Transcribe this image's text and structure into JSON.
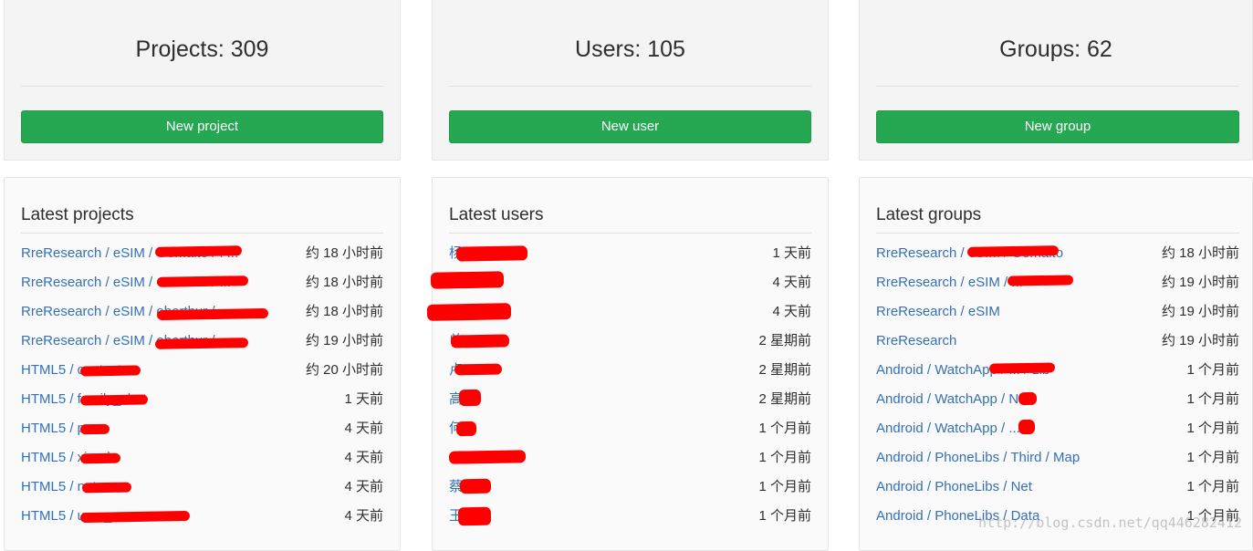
{
  "stats": [
    {
      "title": "Projects: 309",
      "button": "New project"
    },
    {
      "title": "Users: 105",
      "button": "New user"
    },
    {
      "title": "Groups: 62",
      "button": "New group"
    }
  ],
  "lists": [
    {
      "heading": "Latest projects",
      "rows": [
        {
          "name": "RreResearch / eSIM / Gemalto / P...",
          "time": "约 18 小时前"
        },
        {
          "name": "RreResearch / eSIM / Gemalto / ...",
          "time": "约 18 小时前"
        },
        {
          "name": "RreResearch / eSIM / oberthur / ...",
          "time": "约 18 小时前"
        },
        {
          "name": "RreResearch / eSIM / oberthur / ...",
          "time": "约 19 小时前"
        },
        {
          "name": "HTML5 / contact",
          "time": "约 20 小时前"
        },
        {
          "name": "HTML5 / family_chat",
          "time": "1 天前"
        },
        {
          "name": "HTML5 / p...",
          "time": "4 天前"
        },
        {
          "name": "HTML5 / xiaodu",
          "time": "4 天前"
        },
        {
          "name": "HTML5 / netease",
          "time": "4 天前"
        },
        {
          "name": "HTML5 / user_c...",
          "time": "4 天前"
        }
      ]
    },
    {
      "heading": "Latest users",
      "rows": [
        {
          "name": "杨",
          "time": "1 天前"
        },
        {
          "name": "",
          "time": "4 天前"
        },
        {
          "name": "曹",
          "time": "4 天前"
        },
        {
          "name": "曾",
          "time": "2 星期前"
        },
        {
          "name": "卢",
          "time": "2 星期前"
        },
        {
          "name": "高",
          "time": "2 星期前"
        },
        {
          "name": "何",
          "time": "1 个月前"
        },
        {
          "name": "",
          "time": "1 个月前"
        },
        {
          "name": "蔡",
          "time": "1 个月前"
        },
        {
          "name": "王",
          "time": "1 个月前"
        }
      ]
    },
    {
      "heading": "Latest groups",
      "rows": [
        {
          "name": "RreResearch / eSIM / Gemalto",
          "time": "约 18 小时前"
        },
        {
          "name": "RreResearch / eSIM / ...",
          "time": "约 19 小时前"
        },
        {
          "name": "RreResearch / eSIM",
          "time": "约 19 小时前"
        },
        {
          "name": "RreResearch",
          "time": "约 19 小时前"
        },
        {
          "name": "Android / WatchApp / ... / Lib",
          "time": "1 个月前"
        },
        {
          "name": "Android / WatchApp / N...",
          "time": "1 个月前"
        },
        {
          "name": "Android / WatchApp / ...",
          "time": "1 个月前"
        },
        {
          "name": "Android / PhoneLibs / Third / Map",
          "time": "1 个月前"
        },
        {
          "name": "Android / PhoneLibs / Net",
          "time": "1 个月前"
        },
        {
          "name": "Android / PhoneLibs / Data",
          "time": "1 个月前"
        }
      ]
    }
  ],
  "watermark": "http://blog.csdn.net/qq446282412",
  "colors": {
    "button_green": "#26a852",
    "link_blue": "#3470b5",
    "redaction_red": "#ff0000"
  }
}
